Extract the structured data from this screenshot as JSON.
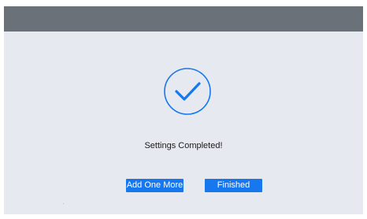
{
  "dialog": {
    "status_message": "Settings Completed!",
    "icon": "check-circle-icon",
    "accent_color": "#1677ee"
  },
  "actions": {
    "add_one_more_label": "Add One More",
    "finished_label": "Finished"
  },
  "colors": {
    "topbar": "#6b7178",
    "background": "#e6eaf0",
    "button": "#1677ee"
  }
}
